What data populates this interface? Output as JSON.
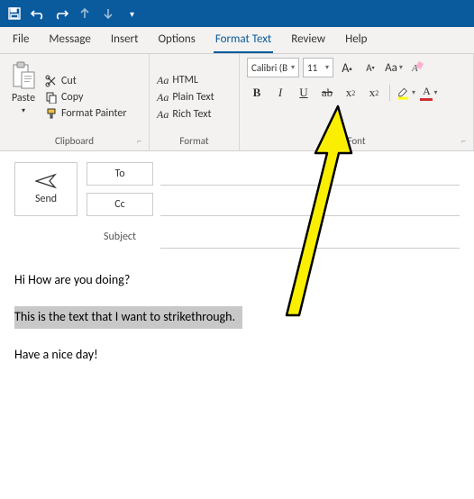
{
  "tabs": {
    "file": "File",
    "message": "Message",
    "insert": "Insert",
    "options": "Options",
    "format_text": "Format Text",
    "review": "Review",
    "help": "Help"
  },
  "clipboard": {
    "paste": "Paste",
    "cut": "Cut",
    "copy": "Copy",
    "format_painter": "Format Painter",
    "group_label": "Clipboard"
  },
  "format": {
    "html": "HTML",
    "plain": "Plain Text",
    "rich": "Rich Text",
    "aa": "Aa",
    "group_label": "Format"
  },
  "font": {
    "name": "Calibri (B",
    "size": "11",
    "larger_a": "A",
    "smaller_a": "A",
    "aa": "Aa",
    "bold": "B",
    "italic": "I",
    "underline": "U",
    "strikethrough": "ab",
    "subscript": "x",
    "subscript_sub": "2",
    "superscript": "x",
    "superscript_sup": "2",
    "highlight_color": "#ffff00",
    "font_color": "#d03030",
    "group_label": "Font"
  },
  "compose": {
    "send": "Send",
    "to": "To",
    "cc": "Cc",
    "subject": "Subject"
  },
  "body": {
    "line1": "Hi How are you doing?",
    "line2": "This is the text that I want to strikethrough.",
    "line3": "Have a nice day!"
  }
}
